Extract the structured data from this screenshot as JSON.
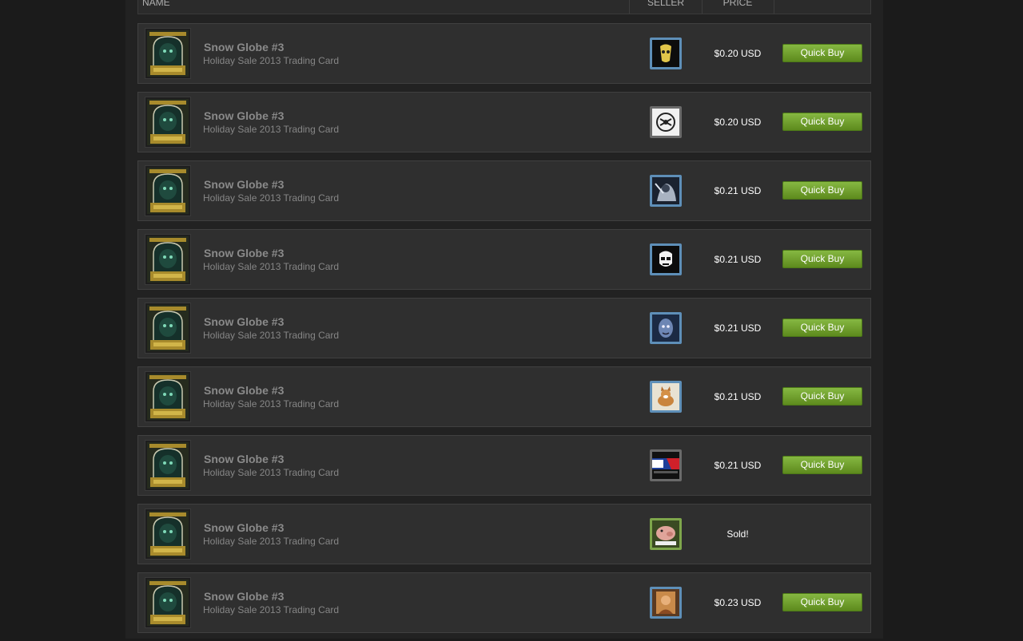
{
  "header": {
    "name": "NAME",
    "seller": "SELLER",
    "price": "PRICE"
  },
  "listings": [
    {
      "name": "Snow Globe #3",
      "type": "Holiday Sale 2013 Trading Card",
      "price": "$0.20 USD",
      "action": "Quick Buy",
      "avatar": "yellow-mask-avatar"
    },
    {
      "name": "Snow Globe #3",
      "type": "Holiday Sale 2013 Trading Card",
      "price": "$0.20 USD",
      "action": "Quick Buy",
      "avatar": "dishonored-emblem-avatar"
    },
    {
      "name": "Snow Globe #3",
      "type": "Holiday Sale 2013 Trading Card",
      "price": "$0.21 USD",
      "action": "Quick Buy",
      "avatar": "dark-character-avatar"
    },
    {
      "name": "Snow Globe #3",
      "type": "Holiday Sale 2013 Trading Card",
      "price": "$0.21 USD",
      "action": "Quick Buy",
      "avatar": "stormtrooper-avatar"
    },
    {
      "name": "Snow Globe #3",
      "type": "Holiday Sale 2013 Trading Card",
      "price": "$0.21 USD",
      "action": "Quick Buy",
      "avatar": "blue-face-avatar"
    },
    {
      "name": "Snow Globe #3",
      "type": "Holiday Sale 2013 Trading Card",
      "price": "$0.21 USD",
      "action": "Quick Buy",
      "avatar": "corgi-avatar"
    },
    {
      "name": "Snow Globe #3",
      "type": "Holiday Sale 2013 Trading Card",
      "price": "$0.21 USD",
      "action": "Quick Buy",
      "avatar": "league-logo-avatar"
    },
    {
      "name": "Snow Globe #3",
      "type": "Holiday Sale 2013 Trading Card",
      "price": "Sold!",
      "action": "",
      "avatar": "pig-avatar"
    },
    {
      "name": "Snow Globe #3",
      "type": "Holiday Sale 2013 Trading Card",
      "price": "$0.23 USD",
      "action": "Quick Buy",
      "avatar": "portrait-avatar"
    }
  ]
}
